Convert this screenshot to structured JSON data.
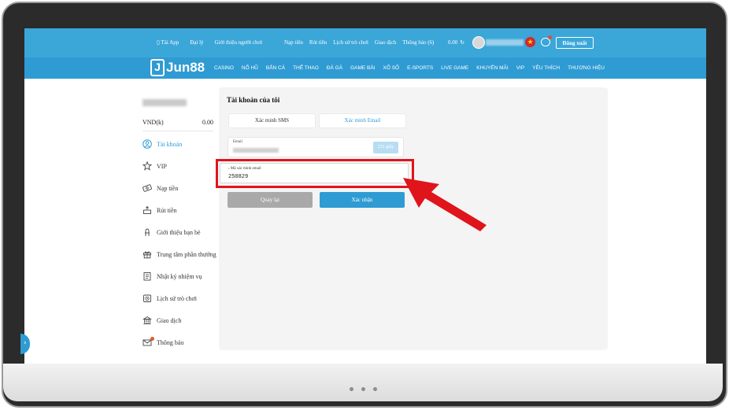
{
  "topbar": {
    "links": [
      "Tải App",
      "Đại lý",
      "Giới thiệu người chơi"
    ],
    "actions": [
      "Nạp tiền",
      "Rút tiền",
      "Lịch sử trò chơi",
      "Giao dịch",
      "Thông báo (6)"
    ],
    "balance": "0.00",
    "logout_label": "Đăng xuất"
  },
  "nav": {
    "logo_mark": "J",
    "logo_text": "Jun88",
    "items": [
      "CASINO",
      "NỔ HŨ",
      "BẮN CÁ",
      "THỂ THAO",
      "ĐÁ GÀ",
      "GAME BÀI",
      "XỔ SỐ",
      "E-SPORTS",
      "LIVE GAME",
      "KHUYẾN MÃI",
      "VIP",
      "YÊU THÍCH",
      "THƯƠNG HIỆU"
    ]
  },
  "sidebar": {
    "currency": "VND(k)",
    "amount": "0.00",
    "items": [
      {
        "label": "Tài khoản",
        "icon": "user-icon"
      },
      {
        "label": "VIP",
        "icon": "vip-icon"
      },
      {
        "label": "Nạp tiền",
        "icon": "deposit-icon"
      },
      {
        "label": "Rút tiền",
        "icon": "withdraw-icon"
      },
      {
        "label": "Giới thiệu bạn bè",
        "icon": "referral-icon"
      },
      {
        "label": "Trung tâm phần thưởng",
        "icon": "gift-icon"
      },
      {
        "label": "Nhật ký nhiệm vụ",
        "icon": "task-log-icon"
      },
      {
        "label": "Lịch sử trò chơi",
        "icon": "history-icon"
      },
      {
        "label": "Giao dịch",
        "icon": "transaction-icon"
      },
      {
        "label": "Thông báo",
        "icon": "mail-icon"
      }
    ]
  },
  "panel": {
    "title": "Tài khoản của tôi",
    "tabs": [
      "Xác minh SMS",
      "Xác minh Email"
    ],
    "email_label": "Email",
    "countdown": "231 giây",
    "code_label": "Mã xác minh email",
    "code_value": "250829",
    "back_label": "Quay lại",
    "confirm_label": "Xác nhận"
  },
  "colors": {
    "header": "#3ba6d8",
    "nav": "#2f9bd3",
    "accent": "#2f9bd3",
    "highlight": "#e0141b"
  }
}
